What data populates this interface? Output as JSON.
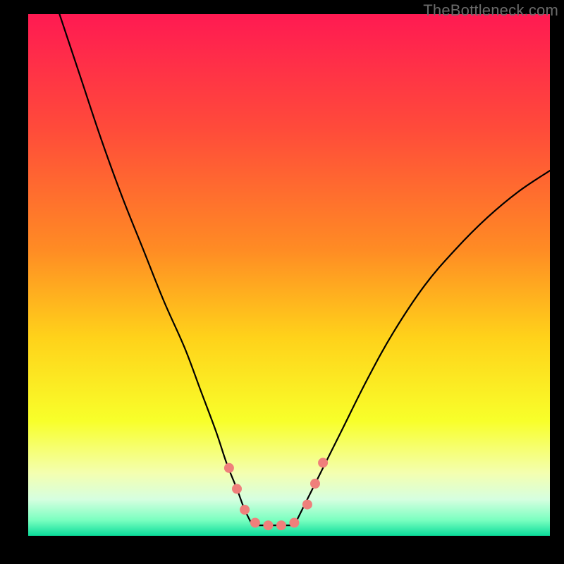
{
  "watermark": "TheBottleneck.com",
  "chart_data": {
    "type": "line",
    "title": "",
    "xlabel": "",
    "ylabel": "",
    "xlim": [
      0,
      100
    ],
    "ylim": [
      0,
      100
    ],
    "grid": false,
    "legend": false,
    "annotations": [],
    "background_gradient": {
      "type": "vertical",
      "stops": [
        {
          "offset": 0.0,
          "color": "#ff1a52"
        },
        {
          "offset": 0.22,
          "color": "#ff4b3a"
        },
        {
          "offset": 0.45,
          "color": "#ff8b24"
        },
        {
          "offset": 0.62,
          "color": "#ffd21a"
        },
        {
          "offset": 0.78,
          "color": "#f8ff2a"
        },
        {
          "offset": 0.88,
          "color": "#f4ffb0"
        },
        {
          "offset": 0.93,
          "color": "#d6ffe0"
        },
        {
          "offset": 0.97,
          "color": "#7affc0"
        },
        {
          "offset": 1.0,
          "color": "#0bdc9a"
        }
      ]
    },
    "series": [
      {
        "name": "left-branch",
        "color": "#000000",
        "stroke_width": 2.2,
        "x": [
          6,
          10,
          14,
          18,
          22,
          26,
          30,
          33,
          36,
          38,
          40,
          41.5,
          43
        ],
        "y": [
          100,
          88,
          76,
          65,
          55,
          45,
          36,
          28,
          20,
          14,
          9,
          5,
          2
        ]
      },
      {
        "name": "right-branch",
        "color": "#000000",
        "stroke_width": 2.2,
        "x": [
          51,
          53,
          56,
          60,
          65,
          70,
          76,
          82,
          88,
          94,
          100
        ],
        "y": [
          2,
          6,
          12,
          20,
          30,
          39,
          48,
          55,
          61,
          66,
          70
        ]
      },
      {
        "name": "floor",
        "color": "#000000",
        "stroke_width": 2.2,
        "x": [
          43,
          51
        ],
        "y": [
          2,
          2
        ]
      }
    ],
    "markers": {
      "name": "highlight-dots",
      "color": "#ef7f7b",
      "radius": 7,
      "points": [
        {
          "x": 38.5,
          "y": 13
        },
        {
          "x": 40.0,
          "y": 9
        },
        {
          "x": 41.5,
          "y": 5
        },
        {
          "x": 43.5,
          "y": 2.5
        },
        {
          "x": 46.0,
          "y": 2
        },
        {
          "x": 48.5,
          "y": 2
        },
        {
          "x": 51.0,
          "y": 2.5
        },
        {
          "x": 53.5,
          "y": 6
        },
        {
          "x": 55.0,
          "y": 10
        },
        {
          "x": 56.5,
          "y": 14
        }
      ]
    }
  }
}
